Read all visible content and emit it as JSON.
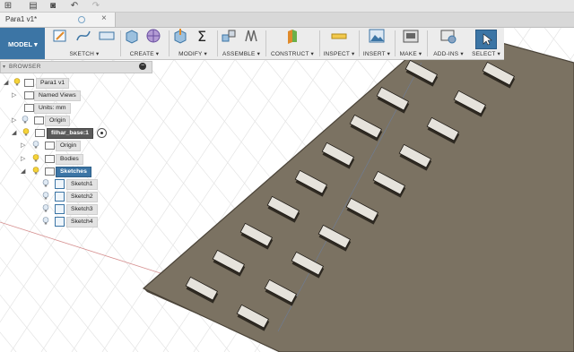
{
  "document": {
    "tab_title": "Para1 v1*"
  },
  "toolbar": {
    "mode_label": "MODEL ▾",
    "groups": [
      {
        "label": "SKETCH ▾"
      },
      {
        "label": "CREATE ▾"
      },
      {
        "label": "MODIFY ▾"
      },
      {
        "label": "ASSEMBLE ▾"
      },
      {
        "label": "CONSTRUCT ▾"
      },
      {
        "label": "INSPECT ▾"
      },
      {
        "label": "INSERT ▾"
      },
      {
        "label": "MAKE ▾"
      },
      {
        "label": "ADD-INS ▾"
      },
      {
        "label": "SELECT ▾"
      }
    ]
  },
  "browser": {
    "title": "BROWSER",
    "root": "Para1 v1",
    "named_views": "Named Views",
    "units": "Units: mm",
    "origin": "Origin",
    "component": "filhar_base:1",
    "component_origin": "Origin",
    "bodies": "Bodies",
    "sketches": "Sketches",
    "sketch_items": [
      "Sketch1",
      "Sketch2",
      "Sketch3",
      "Sketch4"
    ]
  },
  "colors": {
    "accent": "#3c75a5",
    "plate": "#7b7262",
    "plate_edge": "#4a4338",
    "pad": "#e6e3dc"
  }
}
